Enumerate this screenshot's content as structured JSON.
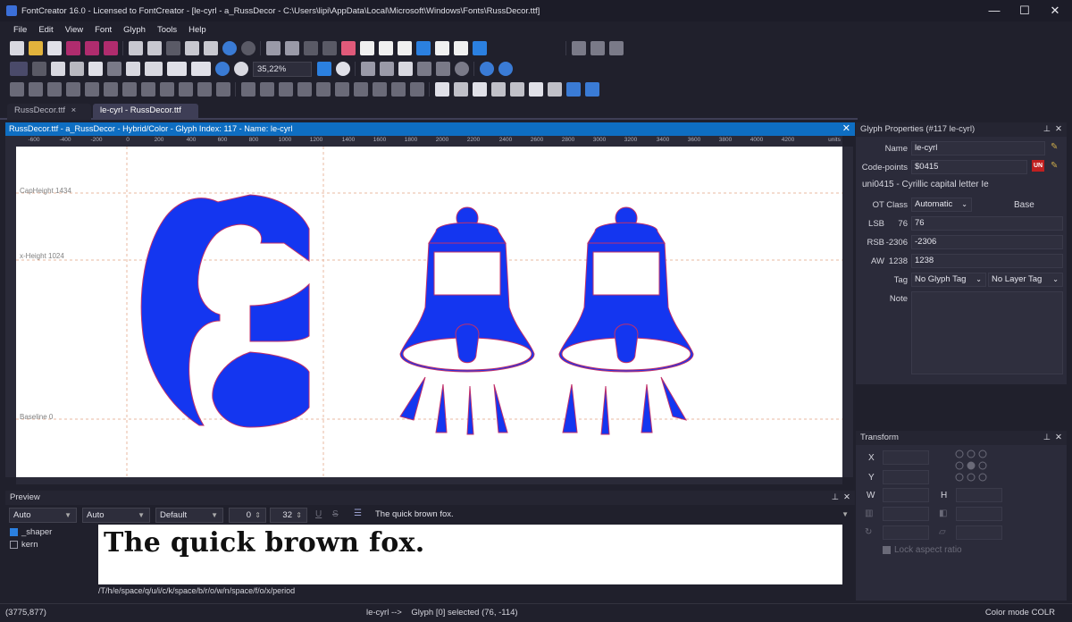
{
  "app": {
    "title": "FontCreator 16.0 - Licensed to FontCreator - [le-cyrl - a_RussDecor - C:\\Users\\lipi\\AppData\\Local\\Microsoft\\Windows\\Fonts\\RussDecor.ttf]",
    "minimize": "—",
    "maximize": "☐",
    "close": "✕"
  },
  "menu": [
    "File",
    "Edit",
    "View",
    "Font",
    "Glyph",
    "Tools",
    "Help"
  ],
  "toolbar": {
    "zoom": "35,22%",
    "accent": "#3a7bd5"
  },
  "tabs": [
    {
      "label": "RussDecor.ttf",
      "close": "×",
      "active": false
    },
    {
      "label": "le-cyrl - RussDecor.ttf",
      "active": true
    }
  ],
  "editor": {
    "header": "RussDecor.ttf - a_RussDecor - Hybrid/Color - Glyph Index: 117 - Name: le-cyrl",
    "close": "✕",
    "ruler_labels": [
      "-600",
      "-400",
      "-200",
      "0",
      "200",
      "400",
      "600",
      "800",
      "1000",
      "1200",
      "1400",
      "1600",
      "1800",
      "2000",
      "2200",
      "2400",
      "2600",
      "2800",
      "3000",
      "3200",
      "3400",
      "3600",
      "3800",
      "4000",
      "4200"
    ],
    "ruler_unit": "units",
    "metrics": {
      "capheight": "CapHeight 1434",
      "xheight": "x-Height 1024",
      "baseline": "Baseline 0"
    },
    "glyph_color": "#1436f0",
    "glyph_outline": "#c0306a"
  },
  "preview": {
    "title": "Preview",
    "script": "Auto",
    "language": "Auto",
    "layout": "Default",
    "spacing": "0",
    "size": "32",
    "underline": "U",
    "strike": "S",
    "text_input": "The quick brown fox.",
    "features": [
      {
        "name": "_shaper",
        "checked": true
      },
      {
        "name": "kern",
        "checked": false
      }
    ],
    "rendered_text": "The quick brown fox.",
    "glyph_sequence": "/T/h/e/space/q/u/i/c/k/space/b/r/o/w/n/space/f/o/x/period"
  },
  "properties": {
    "title": "Glyph Properties (#117 le-cyrl)",
    "name_label": "Name",
    "name_value": "le-cyrl",
    "codepoints_label": "Code-points",
    "codepoints_value": "$0415",
    "unicode_desc": "uni0415 - Cyrillic capital letter Ie",
    "unicode_badge": "UN",
    "otclass_label": "OT Class",
    "otclass_value": "Automatic",
    "otclass_type": "Base",
    "lsb_label": "LSB",
    "lsb_current": "76",
    "lsb_value": "76",
    "rsb_label": "RSB",
    "rsb_current": "-2306",
    "rsb_value": "-2306",
    "aw_label": "AW",
    "aw_current": "1238",
    "aw_value": "1238",
    "tag_label": "Tag",
    "glyph_tag": "No Glyph Tag",
    "layer_tag": "No Layer Tag",
    "note_label": "Note"
  },
  "transform": {
    "title": "Transform",
    "x_label": "X",
    "y_label": "Y",
    "w_label": "W",
    "h_label": "H",
    "lock_aspect": "Lock aspect ratio"
  },
  "status": {
    "coords": "(3775,877)",
    "selection": "le-cyrl -->    Glyph [0] selected (76, -114)",
    "color_mode": "Color mode COLR"
  }
}
